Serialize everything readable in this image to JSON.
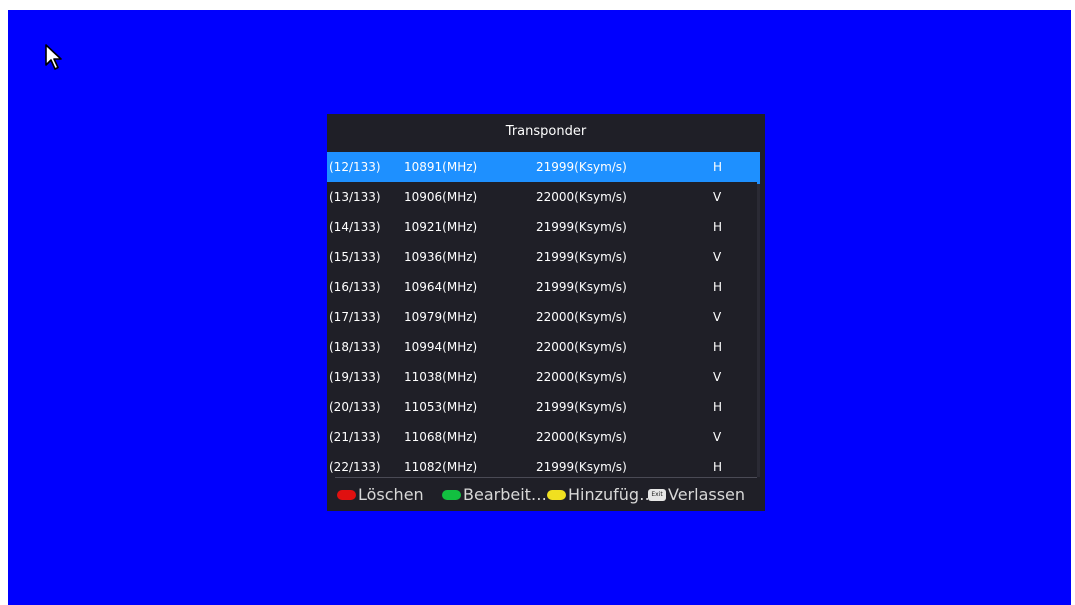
{
  "dialog": {
    "title": "Transponder"
  },
  "transponders": [
    {
      "index": "(12/133)",
      "frequency": "10891(MHz)",
      "symbol_rate": "21999(Ksym/s)",
      "polarization": "H",
      "selected": true
    },
    {
      "index": "(13/133)",
      "frequency": "10906(MHz)",
      "symbol_rate": "22000(Ksym/s)",
      "polarization": "V",
      "selected": false
    },
    {
      "index": "(14/133)",
      "frequency": "10921(MHz)",
      "symbol_rate": "21999(Ksym/s)",
      "polarization": "H",
      "selected": false
    },
    {
      "index": "(15/133)",
      "frequency": "10936(MHz)",
      "symbol_rate": "21999(Ksym/s)",
      "polarization": "V",
      "selected": false
    },
    {
      "index": "(16/133)",
      "frequency": "10964(MHz)",
      "symbol_rate": "21999(Ksym/s)",
      "polarization": "H",
      "selected": false
    },
    {
      "index": "(17/133)",
      "frequency": "10979(MHz)",
      "symbol_rate": "22000(Ksym/s)",
      "polarization": "V",
      "selected": false
    },
    {
      "index": "(18/133)",
      "frequency": "10994(MHz)",
      "symbol_rate": "22000(Ksym/s)",
      "polarization": "H",
      "selected": false
    },
    {
      "index": "(19/133)",
      "frequency": "11038(MHz)",
      "symbol_rate": "22000(Ksym/s)",
      "polarization": "V",
      "selected": false
    },
    {
      "index": "(20/133)",
      "frequency": "11053(MHz)",
      "symbol_rate": "21999(Ksym/s)",
      "polarization": "H",
      "selected": false
    },
    {
      "index": "(21/133)",
      "frequency": "11068(MHz)",
      "symbol_rate": "22000(Ksym/s)",
      "polarization": "V",
      "selected": false
    },
    {
      "index": "(22/133)",
      "frequency": "11082(MHz)",
      "symbol_rate": "21999(Ksym/s)",
      "polarization": "H",
      "selected": false
    }
  ],
  "footer": {
    "delete": {
      "label": "Löschen",
      "key_color": "#e01010",
      "icon": "red-key-icon"
    },
    "edit": {
      "label": "Bearbeit…",
      "key_color": "#12c040",
      "icon": "green-key-icon"
    },
    "add": {
      "label": "Hinzufüg…",
      "key_color": "#f0e020",
      "icon": "yellow-key-icon"
    },
    "exit": {
      "label": "Verlassen",
      "key_text": "Exit",
      "icon": "exit-key-icon"
    }
  },
  "colors": {
    "background": "#0000fe",
    "dialog": "#1f1f27",
    "selection": "#1e90ff"
  }
}
